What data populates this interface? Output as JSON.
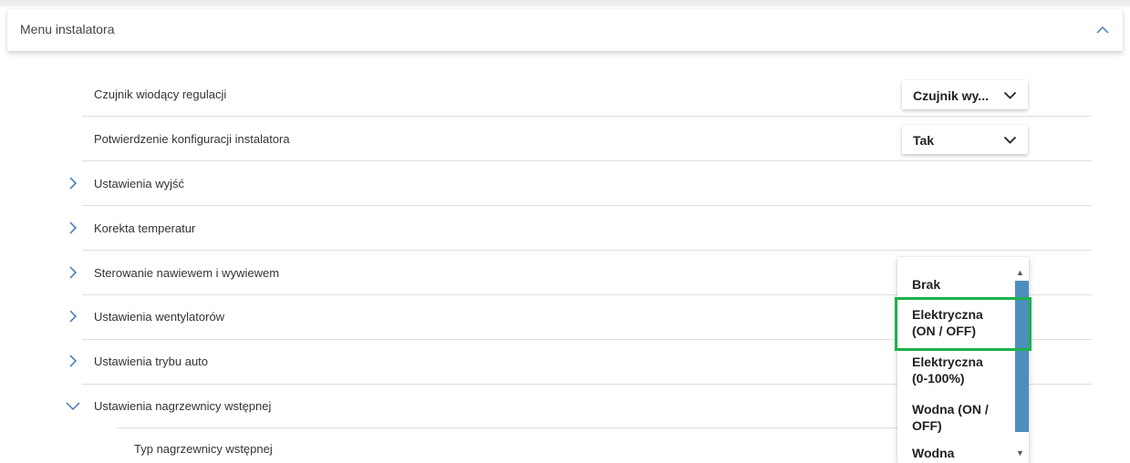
{
  "header": {
    "title": "Menu instalatora"
  },
  "rows": [
    {
      "label": "Czujnik wiodący regulacji",
      "select_value": "Czujnik wy..."
    },
    {
      "label": "Potwierdzenie konfiguracji instalatora",
      "select_value": "Tak"
    },
    {
      "label": "Ustawienia wyjść"
    },
    {
      "label": "Korekta temperatur"
    },
    {
      "label": "Sterowanie nawiewem i wywiewem"
    },
    {
      "label": "Ustawienia wentylatorów"
    },
    {
      "label": "Ustawienia trybu auto"
    },
    {
      "label": "Ustawienia nagrzewnicy wstępnej"
    },
    {
      "label": "Typ nagrzewnicy wstępnej"
    }
  ],
  "dropdown": {
    "options": [
      {
        "line1": "Brak",
        "line2": ""
      },
      {
        "line1": "Elektryczna",
        "line2": "(ON / OFF)"
      },
      {
        "line1": "Elektryczna",
        "line2": "(0-100%)"
      },
      {
        "line1": "Wodna (ON /",
        "line2": "OFF)"
      },
      {
        "line1": "Wodna",
        "line2": ""
      }
    ],
    "highlighted_option": "Elektryczna (ON / OFF)"
  },
  "colors": {
    "accent": "#4d8ebd",
    "highlight_border": "#1cb14a",
    "chevron": "#3f78b4"
  },
  "icons": {
    "collapse": "chevron-up-icon",
    "expand": "chevron-right-icon",
    "expanded": "chevron-down-icon",
    "select": "chevron-down-icon"
  }
}
